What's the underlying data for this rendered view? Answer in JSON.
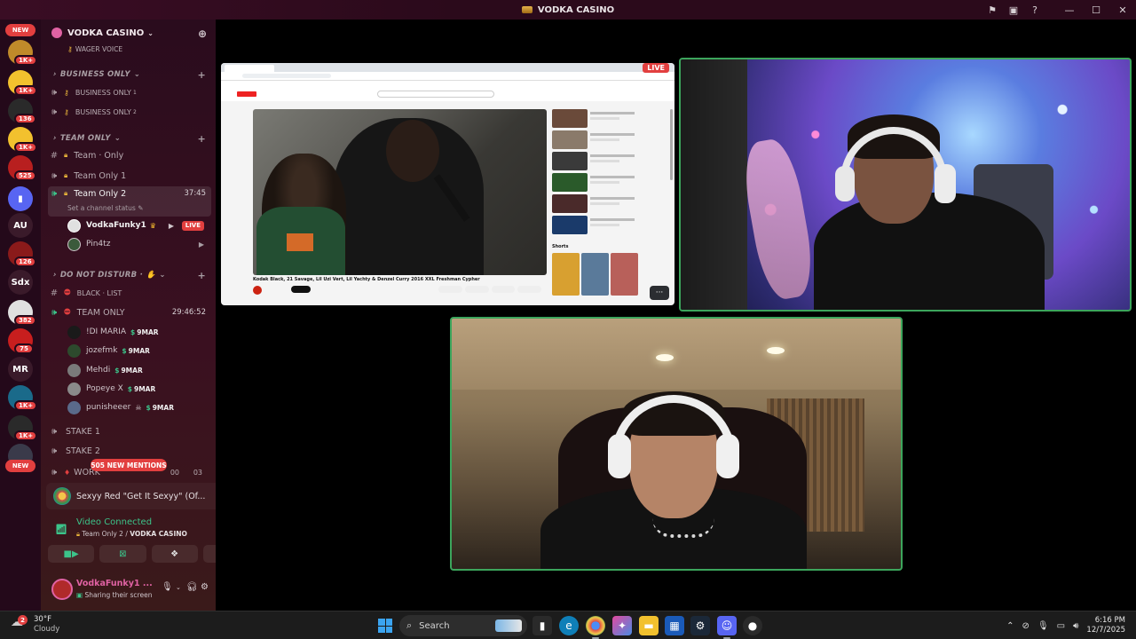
{
  "window": {
    "title": "VODKA CASINO",
    "controls": {
      "minimize": "—",
      "maximize": "☐",
      "close": "✕"
    },
    "icons": [
      "inbox-icon",
      "screen-share-icon",
      "help-icon"
    ]
  },
  "rail": {
    "top_pill": "NEW",
    "bottom_pill": "NEW",
    "servers": [
      {
        "label": "",
        "badge": "1K+",
        "color": "#c08a2a"
      },
      {
        "label": "",
        "badge": "1K+",
        "color": "#f2c12e"
      },
      {
        "label": "",
        "badge": "136",
        "color": "#2a2a2a"
      },
      {
        "label": "",
        "badge": "1K+",
        "color": "#f2c12e"
      },
      {
        "label": "",
        "badge": "525",
        "color": "#b81f1f"
      },
      {
        "label": "▮",
        "badge": "",
        "color": "#5865f2"
      },
      {
        "label": "AU",
        "badge": "",
        "color": "#3a1a2a"
      },
      {
        "label": "",
        "badge": "126",
        "color": "#8a1a1a"
      },
      {
        "label": "Sdx",
        "badge": "",
        "color": "#3a1a2a"
      },
      {
        "label": "",
        "badge": "382",
        "color": "#e0e0e0"
      },
      {
        "label": "",
        "badge": "75",
        "color": "#c81e1e"
      },
      {
        "label": "MR",
        "badge": "",
        "color": "#3a1a2a"
      },
      {
        "label": "",
        "badge": "1K+",
        "color": "#1a6a8a"
      },
      {
        "label": "",
        "badge": "1K+",
        "color": "#2a2a2a"
      },
      {
        "label": "",
        "badge": "",
        "color": "#3a3a4a"
      }
    ]
  },
  "sidebar": {
    "guild_name": "VODKA CASINO",
    "top_partial": "WAGER VOICE",
    "categories": {
      "business": "BUSINESS ONLY",
      "team": "TEAM ONLY",
      "dnd": "DO NOT DISTURB · ✋"
    },
    "channels": {
      "biz1": "BUSINESS ONLY",
      "biz1_sup": "1",
      "biz2": "BUSINESS ONLY",
      "biz2_sup": "2",
      "team_only": "Team · Only",
      "team1": "Team Only 1",
      "team2": "Team Only 2",
      "team2_time": "37:45",
      "team2_status": "Set a channel status",
      "black_list": "BLACK · LIST",
      "team_caps": "TEAM ONLY",
      "team_caps_time": "29:46:52",
      "stake1": "STAKE 1",
      "stake2": "STAKE 2",
      "work": "WORK",
      "work_counter_a": "00",
      "work_counter_b": "03"
    },
    "voice_users": [
      {
        "name": "VodkaFunky1",
        "live": "LIVE",
        "color": "#f2f2f2",
        "bold": true
      },
      {
        "name": "Pin4tz",
        "color": "#cfc5ca"
      }
    ],
    "members": [
      {
        "name": "!DI MARIA",
        "tag": "9MAR"
      },
      {
        "name": "jozefmk",
        "tag": "9MAR"
      },
      {
        "name": "Mehdi",
        "tag": "9MAR"
      },
      {
        "name": "Popeye X",
        "tag": "9MAR"
      },
      {
        "name": "punisheeer",
        "tag": "9MAR"
      }
    ],
    "mentions": "505 NEW MENTIONS",
    "activity": "Sexyy Red \"Get It Sexyy\" (Of...",
    "voice_connected": {
      "title": "Video Connected",
      "channel": "Team Only 2",
      "separator": " / ",
      "server": "VODKA CASINO"
    },
    "user": {
      "name": "VodkaFunky1 ...",
      "status": "Sharing their screen"
    }
  },
  "stage": {
    "live_label": "LIVE",
    "more_label": "···",
    "video_title": "Kodak Black, 21 Savage, Lil Uzi Vert, Lil Yachty & Denzel Curry 2016 XXL Freshman Cypher",
    "shorts_label": "Shorts"
  },
  "taskbar": {
    "weather_temp": "30°F",
    "weather_cond": "Cloudy",
    "weather_badge": "2",
    "search_label": "Search",
    "time": "6:16 PM",
    "date": "12/7/2025"
  }
}
